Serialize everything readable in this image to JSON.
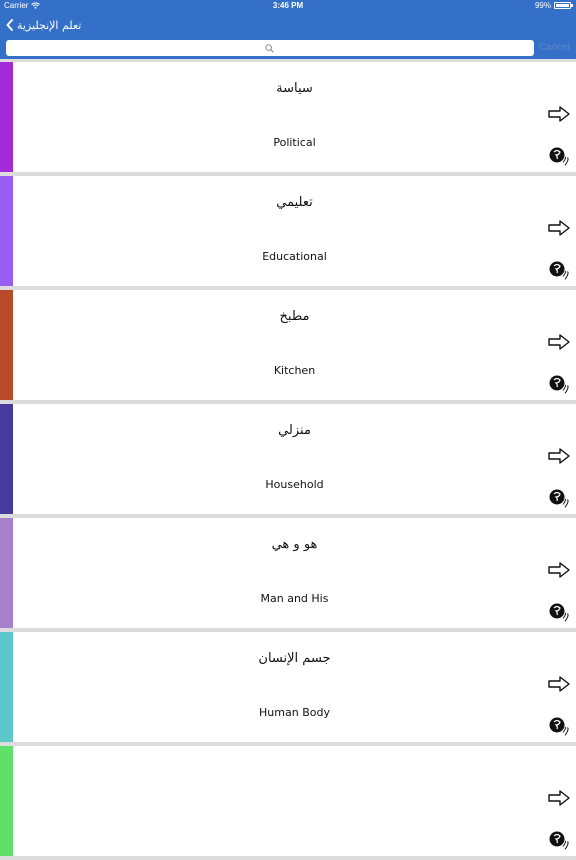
{
  "status_bar": {
    "carrier": "Carrier",
    "time": "3:46 PM",
    "battery": "99%"
  },
  "nav": {
    "back_label": "تعلم الإنجليزية",
    "back_icon": "chevron-left-icon"
  },
  "search": {
    "placeholder": "",
    "cancel_label": "Cancel",
    "icon": "search-icon"
  },
  "cards": [
    {
      "arabic": "سياسة",
      "english": "Political",
      "color": "#a22ad8"
    },
    {
      "arabic": "تعليمي",
      "english": "Educational",
      "color": "#9a5cf2"
    },
    {
      "arabic": "مطبخ",
      "english": "Kitchen",
      "color": "#b84a2c"
    },
    {
      "arabic": "منزلي",
      "english": "Household",
      "color": "#463a9e"
    },
    {
      "arabic": "هو و هي",
      "english": "Man and His",
      "color": "#a77fcb"
    },
    {
      "arabic": "جسم الإنسان",
      "english": "Human Body",
      "color": "#5cc8cc"
    },
    {
      "arabic": "",
      "english": "",
      "color": "#5ee06a"
    }
  ],
  "icons": {
    "arrow": "arrow-right-icon",
    "speaker": "speaker-icon"
  },
  "colors": {
    "nav_bar": "#3470c8",
    "cancel_text": "#5d87c8",
    "background": "#dcdcdc"
  }
}
